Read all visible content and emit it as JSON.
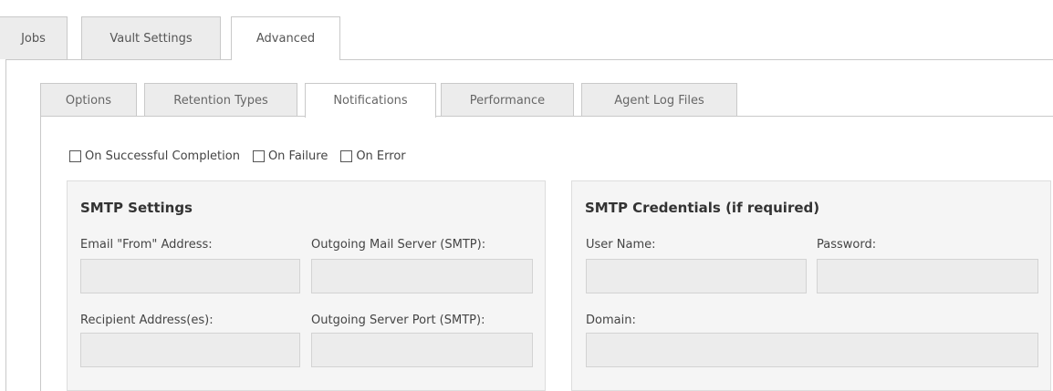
{
  "outer_tabs": [
    {
      "label": "Jobs"
    },
    {
      "label": "Vault Settings"
    },
    {
      "label": "Advanced",
      "active": true
    }
  ],
  "inner_tabs": [
    {
      "label": "Options"
    },
    {
      "label": "Retention Types"
    },
    {
      "label": "Notifications",
      "active": true
    },
    {
      "label": "Performance"
    },
    {
      "label": "Agent Log Files"
    }
  ],
  "notify_options": [
    {
      "label": "On Successful Completion",
      "checked": false
    },
    {
      "label": "On Failure",
      "checked": false
    },
    {
      "label": "On Error",
      "checked": false
    }
  ],
  "smtp_settings": {
    "title": "SMTP Settings",
    "email_from_label": "Email \"From\" Address:",
    "email_from_value": "",
    "mail_server_label": "Outgoing Mail Server (SMTP):",
    "mail_server_value": "",
    "recipients_label": "Recipient Address(es):",
    "recipients_value": "",
    "server_port_label": "Outgoing Server Port (SMTP):",
    "server_port_value": ""
  },
  "smtp_credentials": {
    "title": "SMTP Credentials (if required)",
    "username_label": "User Name:",
    "username_value": "",
    "password_label": "Password:",
    "password_value": "",
    "domain_label": "Domain:",
    "domain_value": ""
  },
  "colors": {
    "tab_inactive_bg": "#ececec",
    "panel_bg": "#f5f5f5",
    "input_bg": "#ececec",
    "border": "#c9c9c9"
  }
}
